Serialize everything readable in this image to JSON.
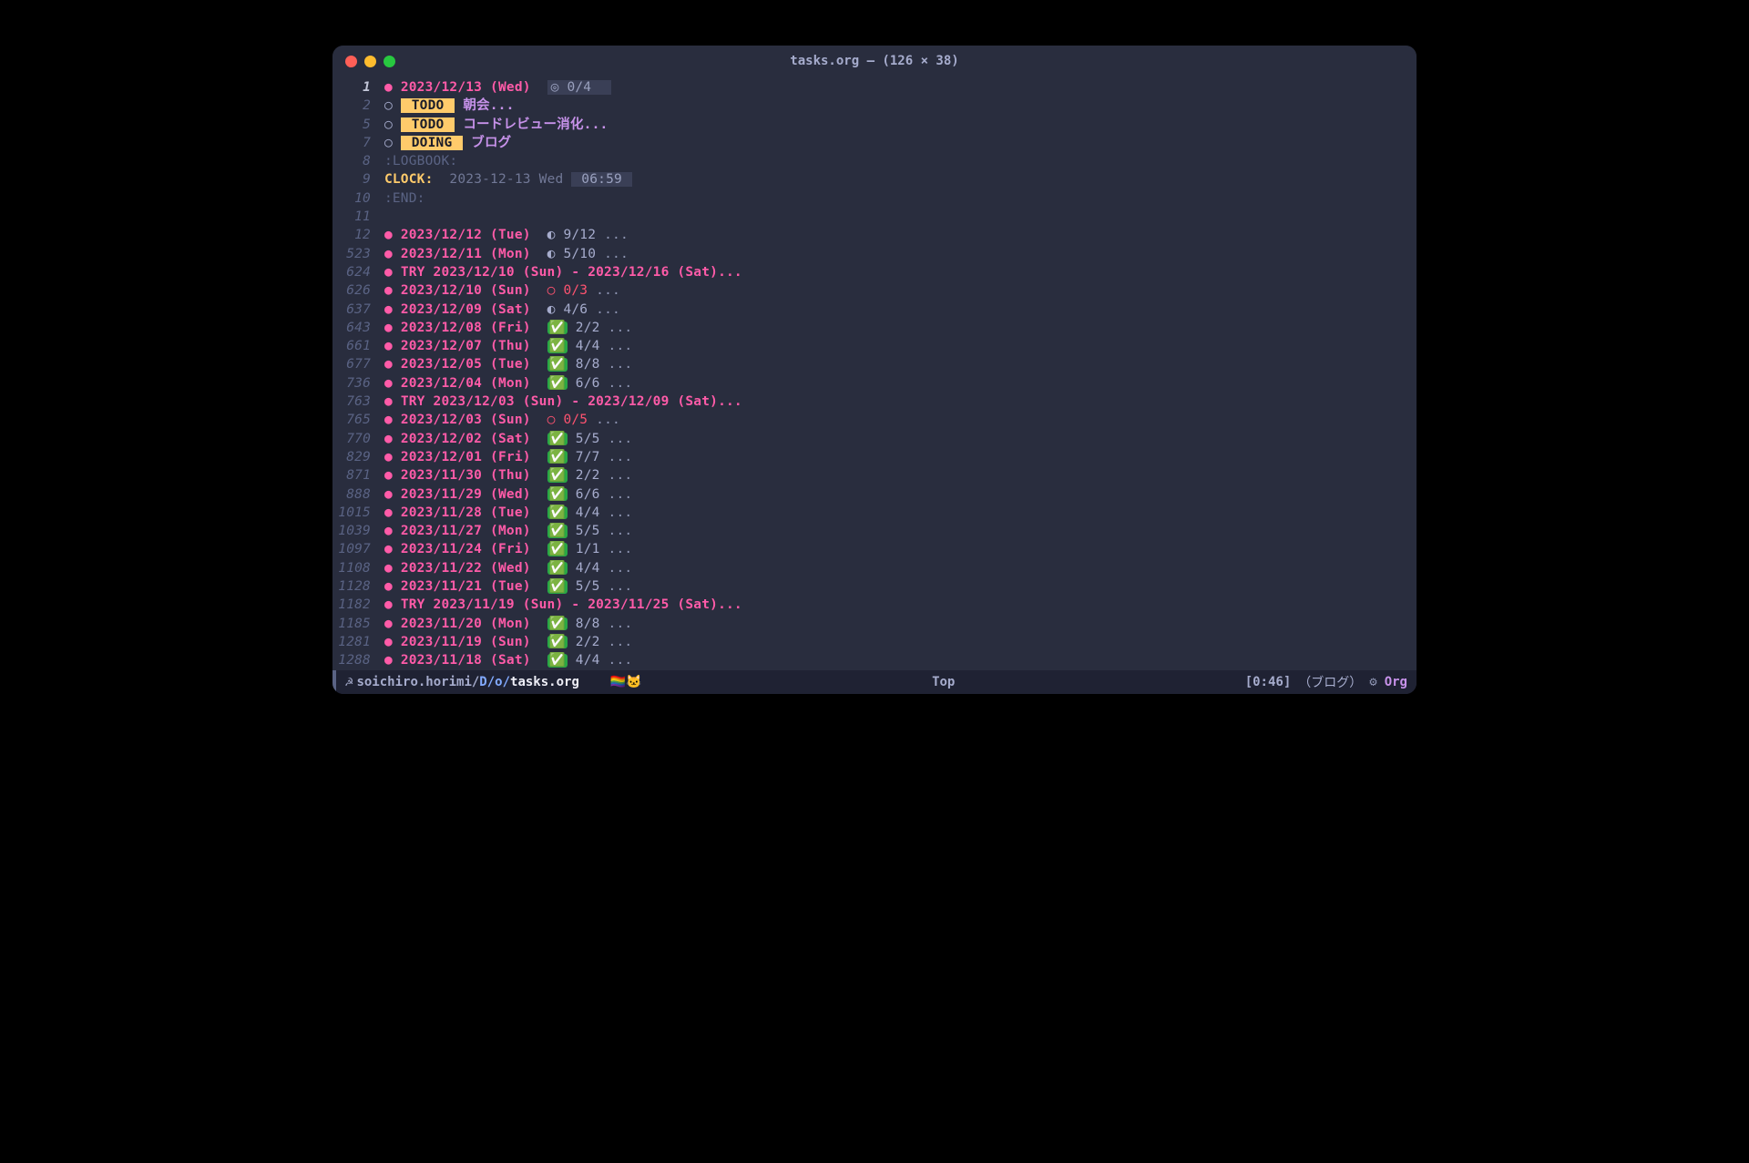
{
  "titlebar": {
    "text": "tasks.org  —  (126 × 38)"
  },
  "lines": [
    {
      "no": "1",
      "noCur": true,
      "type": "date",
      "bullet": "●",
      "date": "2023/12/13 (Wed)",
      "statsHl": "◎ 0/4",
      "trailHl": true
    },
    {
      "no": "2",
      "type": "todo",
      "bullet": "○",
      "tag": "TODO",
      "title": "朝会...",
      "indent": 1
    },
    {
      "no": "5",
      "type": "todo",
      "bullet": "○",
      "tag": "TODO",
      "title": "コードレビュー消化...",
      "indent": 1
    },
    {
      "no": "7",
      "type": "todo",
      "bullet": "○",
      "tag": "DOING",
      "title": "ブログ",
      "indent": 1
    },
    {
      "no": "8",
      "type": "drawer",
      "text": ":LOGBOOK:"
    },
    {
      "no": "9",
      "type": "clock",
      "key": "CLOCK:",
      "date": "2023-12-13 Wed",
      "time": "06:59"
    },
    {
      "no": "10",
      "type": "drawer",
      "text": ":END:"
    },
    {
      "no": "11",
      "type": "blank"
    },
    {
      "no": "12",
      "type": "date",
      "bullet": "●",
      "date": "2023/12/12 (Tue)",
      "stat": "◐ 9/12",
      "statClass": "half",
      "dots": "..."
    },
    {
      "no": "523",
      "type": "date",
      "bullet": "●",
      "date": "2023/12/11 (Mon)",
      "stat": "◐ 5/10",
      "statClass": "half",
      "dots": "..."
    },
    {
      "no": "624",
      "type": "try",
      "bullet": "●",
      "text": "TRY 2023/12/10 (Sun) - 2023/12/16 (Sat)...",
      "dots": ""
    },
    {
      "no": "626",
      "type": "date",
      "bullet": "●",
      "date": "2023/12/10 (Sun)",
      "stat": "○ 0/3",
      "statClass": "red",
      "dots": "..."
    },
    {
      "no": "637",
      "type": "date",
      "bullet": "●",
      "date": "2023/12/09 (Sat)",
      "stat": "◐ 4/6",
      "statClass": "half",
      "dots": "..."
    },
    {
      "no": "643",
      "type": "date",
      "bullet": "●",
      "date": "2023/12/08 (Fri)",
      "check": "2/2",
      "dots": "..."
    },
    {
      "no": "661",
      "type": "date",
      "bullet": "●",
      "date": "2023/12/07 (Thu)",
      "check": "4/4",
      "dots": "..."
    },
    {
      "no": "677",
      "type": "date",
      "bullet": "●",
      "date": "2023/12/05 (Tue)",
      "check": "8/8",
      "dots": "..."
    },
    {
      "no": "736",
      "type": "date",
      "bullet": "●",
      "date": "2023/12/04 (Mon)",
      "check": "6/6",
      "dots": "..."
    },
    {
      "no": "763",
      "type": "try",
      "bullet": "●",
      "text": "TRY 2023/12/03 (Sun) - 2023/12/09 (Sat)...",
      "dots": ""
    },
    {
      "no": "765",
      "type": "date",
      "bullet": "●",
      "date": "2023/12/03 (Sun)",
      "stat": "○ 0/5",
      "statClass": "red",
      "dots": "..."
    },
    {
      "no": "770",
      "type": "date",
      "bullet": "●",
      "date": "2023/12/02 (Sat)",
      "check": "5/5",
      "dots": "..."
    },
    {
      "no": "829",
      "type": "date",
      "bullet": "●",
      "date": "2023/12/01 (Fri)",
      "check": "7/7",
      "dots": "..."
    },
    {
      "no": "871",
      "type": "date",
      "bullet": "●",
      "date": "2023/11/30 (Thu)",
      "check": "2/2",
      "dots": "..."
    },
    {
      "no": "888",
      "type": "date",
      "bullet": "●",
      "date": "2023/11/29 (Wed)",
      "check": "6/6",
      "dots": "..."
    },
    {
      "no": "1015",
      "type": "date",
      "bullet": "●",
      "date": "2023/11/28 (Tue)",
      "check": "4/4",
      "dots": "...",
      "wide": true
    },
    {
      "no": "1039",
      "type": "date",
      "bullet": "●",
      "date": "2023/11/27 (Mon)",
      "check": "5/5",
      "dots": "...",
      "wide": true
    },
    {
      "no": "1097",
      "type": "date",
      "bullet": "●",
      "date": "2023/11/24 (Fri)",
      "check": "1/1",
      "dots": "...",
      "wide": true
    },
    {
      "no": "1108",
      "type": "date",
      "bullet": "●",
      "date": "2023/11/22 (Wed)",
      "check": "4/4",
      "dots": "...",
      "wide": true
    },
    {
      "no": "1128",
      "type": "date",
      "bullet": "●",
      "date": "2023/11/21 (Tue)",
      "check": "5/5",
      "dots": "...",
      "wide": true
    },
    {
      "no": "1182",
      "type": "try",
      "bullet": "●",
      "text": "TRY 2023/11/19 (Sun) - 2023/11/25 (Sat)...",
      "dots": "",
      "wide": true
    },
    {
      "no": "1185",
      "type": "date",
      "bullet": "●",
      "date": "2023/11/20 (Mon)",
      "check": "8/8",
      "dots": "...",
      "wide": true
    },
    {
      "no": "1281",
      "type": "date",
      "bullet": "●",
      "date": "2023/11/19 (Sun)",
      "check": "2/2",
      "dots": "...",
      "wide": true
    },
    {
      "no": "1288",
      "type": "date",
      "bullet": "●",
      "date": "2023/11/18 (Sat)",
      "check": "4/4",
      "dots": "...",
      "wide": true
    }
  ],
  "modeline": {
    "ghost": "☭",
    "pathUser": "soichiro.horimi/",
    "pathBlue": "D/o/",
    "pathFile": "tasks.org",
    "position": "Top",
    "clock": "[0:46]",
    "task": "（ブログ）",
    "mode": "Org",
    "nyan": "🏳️‍🌈🐱"
  }
}
